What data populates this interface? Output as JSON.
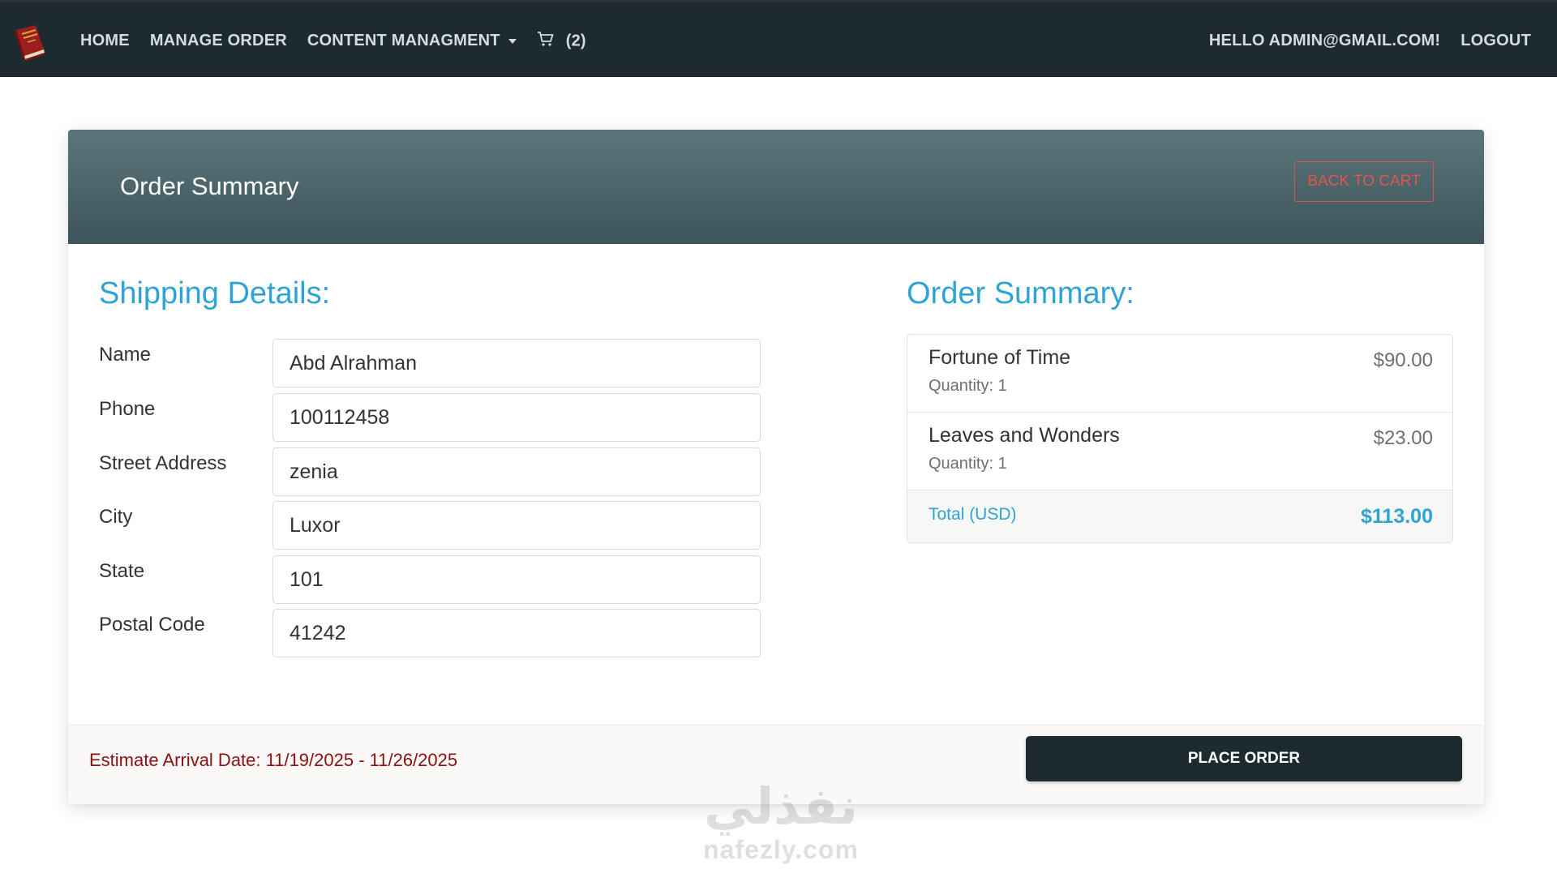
{
  "nav": {
    "links": [
      "HOME",
      "MANAGE ORDER",
      "CONTENT MANAGMENT"
    ],
    "cart_count": "(2)",
    "greeting": "HELLO ADMIN@GMAIL.COM!",
    "logout": "LOGOUT",
    "logo_icon": "book-icon",
    "cart_icon": "cart-icon"
  },
  "card": {
    "title": "Order Summary",
    "back_button": "BACK TO CART"
  },
  "shipping": {
    "heading": "Shipping Details:",
    "fields": [
      {
        "label": "Name",
        "value": "Abd Alrahman"
      },
      {
        "label": "Phone",
        "value": "100112458"
      },
      {
        "label": "Street Address",
        "value": "zenia"
      },
      {
        "label": "City",
        "value": "Luxor"
      },
      {
        "label": "State",
        "value": "101"
      },
      {
        "label": "Postal Code",
        "value": "41242"
      }
    ]
  },
  "summary": {
    "heading": "Order Summary:",
    "items": [
      {
        "name": "Fortune of Time",
        "quantity": "Quantity: 1",
        "price": "$90.00"
      },
      {
        "name": "Leaves and Wonders",
        "quantity": "Quantity: 1",
        "price": "$23.00"
      }
    ],
    "total_label": "Total (USD)",
    "total_value": "$113.00"
  },
  "footer": {
    "arrival": "Estimate Arrival Date: 11/19/2025 - 11/26/2025",
    "place_order": "PLACE ORDER"
  },
  "watermark": {
    "arabic": "نفذلي",
    "latin": "nafezly.com"
  },
  "colors": {
    "navbar": "#1d2b30",
    "accent": "#2ea3d4",
    "danger": "#d9534f",
    "arrival_text": "#8b1010"
  }
}
